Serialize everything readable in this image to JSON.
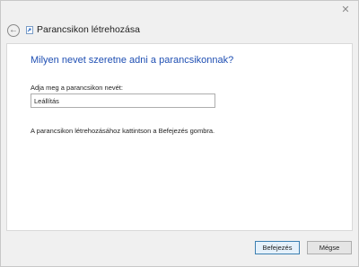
{
  "titlebar": {
    "close_glyph": "✕",
    "close_icon": "close-icon"
  },
  "header": {
    "back_icon": "back-arrow-icon",
    "wizard_icon": "shortcut-icon",
    "title": "Parancsikon létrehozása"
  },
  "content": {
    "question": "Milyen nevet szeretne adni a parancsikonnak?",
    "name_label": "Adja meg a parancsikon nevét:",
    "name_value": "Leállítás",
    "hint": "A parancsikon létrehozásához kattintson a Befejezés gombra."
  },
  "buttons": {
    "finish": "Befejezés",
    "cancel": "Mégse"
  },
  "colors": {
    "heading_blue": "#1f4fb3",
    "content_bg": "#ffffff",
    "window_bg": "#f0f0f0"
  }
}
